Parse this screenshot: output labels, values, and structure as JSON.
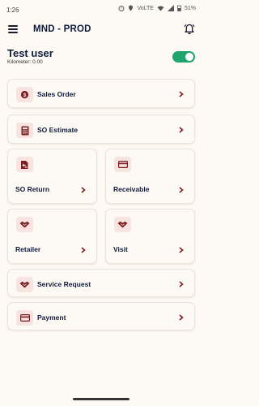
{
  "status_bar": {
    "time": "1:26",
    "battery": "51%",
    "network_label": "VoLTE"
  },
  "app_bar": {
    "title": "MND - PROD",
    "menu_icon": "hamburger-icon",
    "bell_icon": "bell-ringing-icon"
  },
  "user": {
    "name": "Test user",
    "kilometer": "Kilometer: 0.00",
    "toggle_on": true
  },
  "menu": {
    "sales_order": {
      "label": "Sales Order",
      "icon": "dollar-coin-icon"
    },
    "so_estimate": {
      "label": "SO Estimate",
      "icon": "calculator-icon"
    },
    "so_return": {
      "label": "SO Return",
      "icon": "return-document-icon"
    },
    "receivable": {
      "label": "Receivable",
      "icon": "card-icon"
    },
    "retailer": {
      "label": "Retailer",
      "icon": "handshake-icon"
    },
    "visit": {
      "label": "Visit",
      "icon": "handshake-icon"
    },
    "service_request": {
      "label": "Service Request",
      "icon": "handshake-icon"
    },
    "payment": {
      "label": "Payment",
      "icon": "card-icon"
    }
  },
  "colors": {
    "title": "#0f1b3d",
    "accent": "#7a1f1f",
    "icon_bg": "#f7e4e1",
    "toggle": "#1fa56b",
    "background": "#fdf9f4"
  }
}
